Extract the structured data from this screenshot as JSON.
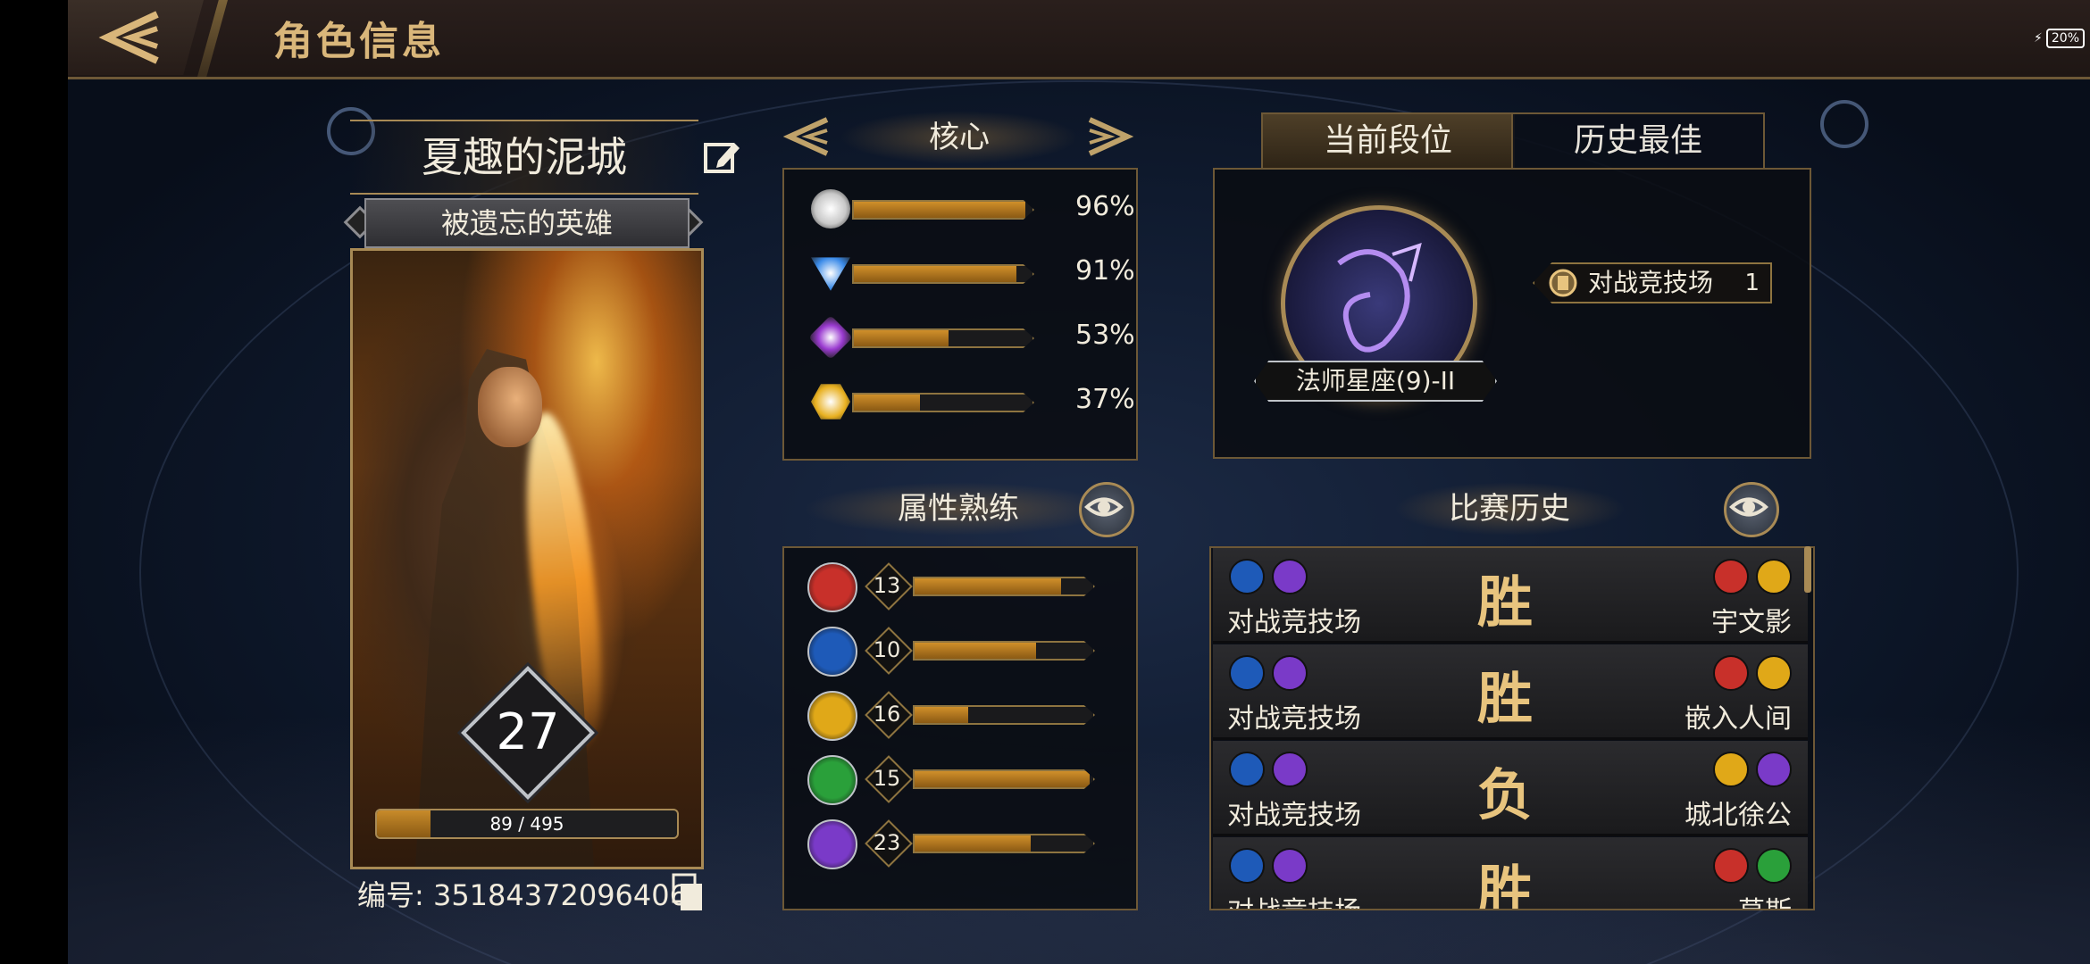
{
  "header": {
    "title": "角色信息",
    "battery": "20%"
  },
  "hero": {
    "name": "夏趣的泥城",
    "title": "被遗忘的英雄",
    "level": "27",
    "xp_text": "89 / 495",
    "xp_fraction": 0.18,
    "id_label": "编号: 35184372096406"
  },
  "core": {
    "title": "核心",
    "rows": [
      {
        "icon": "silver-orb-icon",
        "pct_text": "96%",
        "value": 0.96,
        "color": "#c8c8c8"
      },
      {
        "icon": "blue-triangle-icon",
        "pct_text": "91%",
        "value": 0.91,
        "color": "#3a8ae8"
      },
      {
        "icon": "purple-gem-icon",
        "pct_text": "53%",
        "value": 0.53,
        "color": "#9a3ad0"
      },
      {
        "icon": "gold-hexagon-icon",
        "pct_text": "37%",
        "value": 0.37,
        "color": "#e8b020"
      }
    ]
  },
  "mastery": {
    "title": "属性熟练",
    "rows": [
      {
        "icon": "red-strength-icon",
        "num": "13",
        "value": 0.82,
        "color": "#c8302a"
      },
      {
        "icon": "blue-book-icon",
        "num": "10",
        "value": 0.68,
        "color": "#1e5ab8"
      },
      {
        "icon": "gold-lion-icon",
        "num": "16",
        "value": 0.3,
        "color": "#e0a818"
      },
      {
        "icon": "green-arrow-icon",
        "num": "15",
        "value": 0.98,
        "color": "#2aa03a"
      },
      {
        "icon": "purple-anvil-icon",
        "num": "23",
        "value": 0.65,
        "color": "#7a3ac8"
      }
    ]
  },
  "rank": {
    "tab_current": "当前段位",
    "tab_best": "历史最佳",
    "rank_name": "法师星座(9)-II",
    "mode_name": "对战竞技场",
    "mode_count": "1"
  },
  "history": {
    "title": "比赛历史",
    "matches": [
      {
        "mode": "对战竞技场",
        "result": "胜",
        "opponent": "宇文影",
        "left_icons": [
          "#1e5ab8",
          "#7a3ac8"
        ],
        "right_icons": [
          "#c8302a",
          "#e0a818"
        ]
      },
      {
        "mode": "对战竞技场",
        "result": "胜",
        "opponent": "嵌入人间",
        "left_icons": [
          "#1e5ab8",
          "#7a3ac8"
        ],
        "right_icons": [
          "#c8302a",
          "#e0a818"
        ]
      },
      {
        "mode": "对战竞技场",
        "result": "负",
        "opponent": "城北徐公",
        "left_icons": [
          "#1e5ab8",
          "#7a3ac8"
        ],
        "right_icons": [
          "#e0a818",
          "#7a3ac8"
        ]
      },
      {
        "mode": "对战竞技场",
        "result": "胜",
        "opponent": "草斯",
        "left_icons": [
          "#1e5ab8",
          "#7a3ac8"
        ],
        "right_icons": [
          "#c8302a",
          "#2aa03a"
        ]
      }
    ]
  }
}
